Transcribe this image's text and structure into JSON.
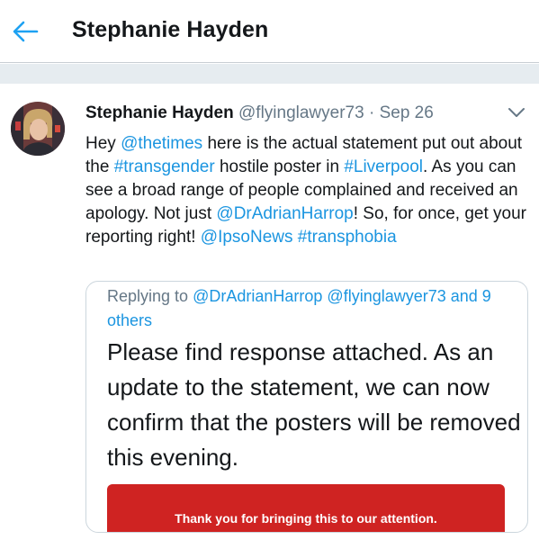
{
  "header": {
    "title": "Stephanie Hayden",
    "back_icon": "arrow-left-icon"
  },
  "colors": {
    "accent": "#1b95e0",
    "secondary_text": "#657786",
    "divider": "#e6ecf0",
    "card_red": "#cf2322"
  },
  "tweet": {
    "author_name": "Stephanie Hayden",
    "author_handle": "@flyinglawyer73",
    "separator": "·",
    "date": "Sep 26",
    "menu_icon": "chevron-down-icon",
    "text": {
      "t1": "Hey ",
      "mention_times": "@thetimes",
      "t2": " here is the actual statement put out about the ",
      "hashtag_transgender": "#transgender",
      "t3": " hostile poster in ",
      "hashtag_liverpool": "#Liverpool",
      "t4": ". As you can see a broad range of people complained and received an apology. Not just ",
      "mention_harrop": "@DrAdrianHarrop",
      "t5": "! So, for once, get your reporting right! ",
      "mention_ipso": "@IpsoNews",
      "hashtag_transphobia": "#transphobia"
    }
  },
  "quoted": {
    "replying_to": "Replying to",
    "mention_harrop": "@DrAdrianHarrop",
    "mention_flying": "@flyinglawyer73",
    "others": "and 9 others",
    "body": "Please find response attached. As an update to the statement, we can now confirm that the posters will be removed this evening.",
    "card_text": "Thank you for bringing this to our attention."
  }
}
